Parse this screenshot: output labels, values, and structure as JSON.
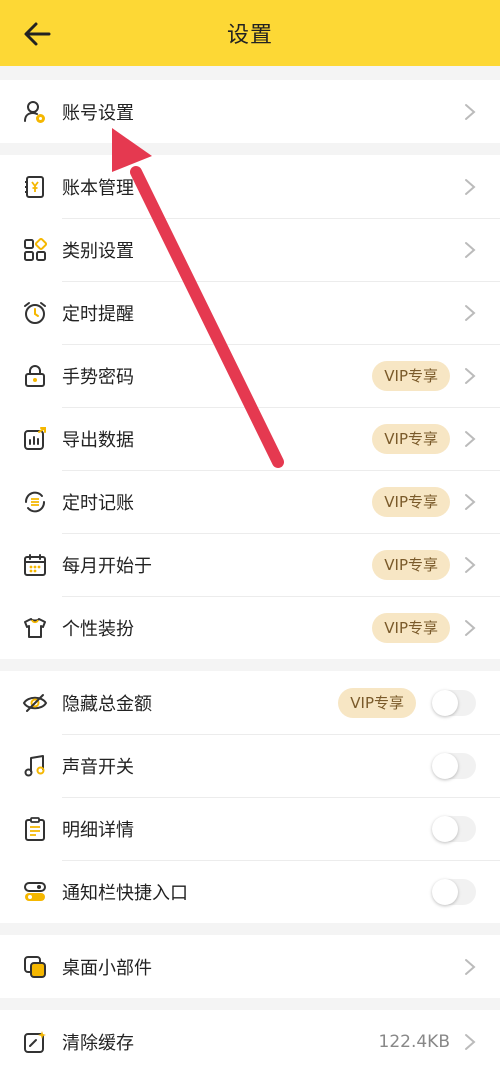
{
  "header": {
    "title": "设置"
  },
  "groups": {
    "account": {
      "items": [
        {
          "label": "账号设置"
        }
      ]
    },
    "main": {
      "items": [
        {
          "label": "账本管理"
        },
        {
          "label": "类别设置"
        },
        {
          "label": "定时提醒"
        },
        {
          "label": "手势密码",
          "badge": "VIP专享"
        },
        {
          "label": "导出数据",
          "badge": "VIP专享"
        },
        {
          "label": "定时记账",
          "badge": "VIP专享"
        },
        {
          "label": "每月开始于",
          "badge": "VIP专享"
        },
        {
          "label": "个性装扮",
          "badge": "VIP专享"
        }
      ]
    },
    "toggles": {
      "items": [
        {
          "label": "隐藏总金额",
          "badge": "VIP专享",
          "enabled": false
        },
        {
          "label": "声音开关",
          "enabled": false
        },
        {
          "label": "明细详情",
          "enabled": false
        },
        {
          "label": "通知栏快捷入口",
          "enabled": false
        }
      ]
    },
    "widgets": {
      "items": [
        {
          "label": "桌面小部件"
        }
      ]
    },
    "cache": {
      "items": [
        {
          "label": "清除缓存",
          "value": "122.4KB"
        }
      ]
    }
  },
  "colors": {
    "header": "#fdd835",
    "icon": "#333333",
    "icon_accent": "#f5b700",
    "vip_bg": "#f7e6c4",
    "arrow": "#e53950"
  }
}
